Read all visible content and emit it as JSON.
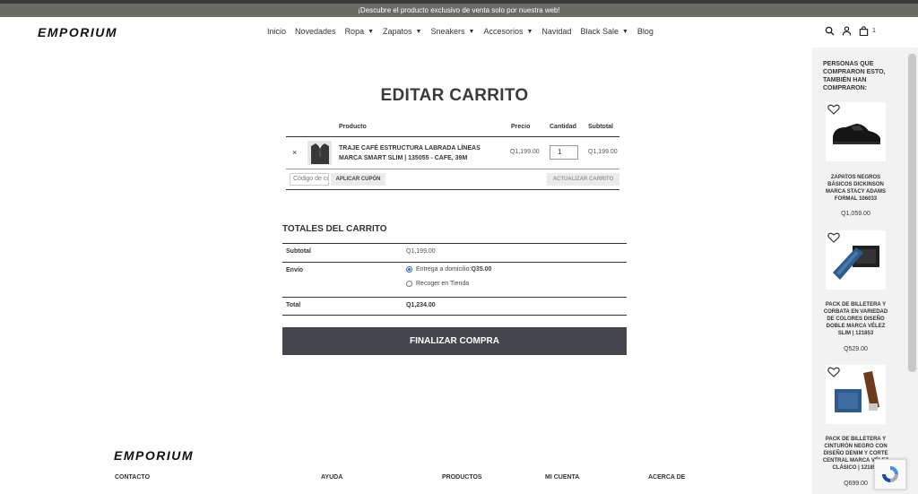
{
  "announcement": "¡Descubre el producto exclusivo de venta solo por nuestra web!",
  "brand": "EMPORIUM",
  "nav": [
    {
      "label": "Inicio",
      "dropdown": false
    },
    {
      "label": "Novedades",
      "dropdown": false
    },
    {
      "label": "Ropa",
      "dropdown": true
    },
    {
      "label": "Zapatos",
      "dropdown": true
    },
    {
      "label": "Sneakers",
      "dropdown": true
    },
    {
      "label": "Accesorios",
      "dropdown": true
    },
    {
      "label": "Navidad",
      "dropdown": false
    },
    {
      "label": "Black Sale",
      "dropdown": true
    },
    {
      "label": "Blog",
      "dropdown": false
    }
  ],
  "header": {
    "cart_count": "1"
  },
  "page_title": "EDITAR CARRITO",
  "cart": {
    "headers": {
      "product": "Producto",
      "price": "Precio",
      "qty": "Cantidad",
      "subtotal": "Subtotal"
    },
    "item": {
      "remove": "×",
      "name": "TRAJE CAFÉ ESTRUCTURA LABRADA LÍNEAS MARCA SMART SLIM | 135055 - CAFE, 39M",
      "price": "Q1,199.00",
      "qty": "1",
      "subtotal": "Q1,199.00"
    },
    "coupon_placeholder": "Código de cupón",
    "apply_coupon": "APLICAR CUPÓN",
    "update_cart": "ACTUALIZAR CARRITO"
  },
  "totals": {
    "title": "TOTALES DEL CARRITO",
    "subtotal_label": "Subtotal",
    "subtotal_value": "Q1,199.00",
    "shipping_label": "Envío",
    "shipping_option_1": "Entrega a domicilio: ",
    "shipping_option_1_price": "Q35.00",
    "shipping_option_2": "Recoger en Tienda",
    "total_label": "Total",
    "total_value": "Q1,234.00",
    "checkout": "FINALIZAR COMPRA"
  },
  "footer": {
    "brand": "EMPORIUM",
    "columns": [
      "CONTACTO",
      "AYUDA",
      "PRODUCTOS",
      "MI CUENTA",
      "ACERCA DE"
    ]
  },
  "sidebar": {
    "title": "PERSONAS QUE COMPRARON ESTO, TAMBIÉN HAN COMPRARON:",
    "items": [
      {
        "name": "ZAPATOS NEGROS BÁSICOS DICKINSON MARCA STACY ADAMS FORMAL 106033",
        "price": "Q1,059.00"
      },
      {
        "name": "PACK DE BILLETERA Y CORBATA EN VARIEDAD DE COLORES DISEÑO DOBLE MARCA VÉLEZ SLIM | 121853",
        "price": "Q529.00"
      },
      {
        "name": "PACK DE BILLETERA Y CINTURÓN NEGRO CON DISEÑO DENIM Y CORTE CENTRAL MARCA VÉLEZ CLÁSICO | 121854",
        "price": "Q699.00"
      }
    ]
  }
}
